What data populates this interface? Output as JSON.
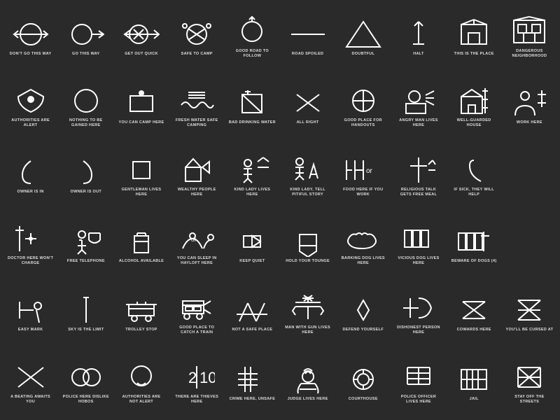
{
  "cells": [
    {
      "id": "dont-go-this-way",
      "label": "DON'T GO THIS WAY"
    },
    {
      "id": "go-this-way",
      "label": "GO THIS WAY"
    },
    {
      "id": "get-out-quick",
      "label": "GET OUT QUICK"
    },
    {
      "id": "safe-to-camp",
      "label": "SAFE TO CAMP"
    },
    {
      "id": "good-road-to-follow",
      "label": "GOOD ROAD TO FOLLOW"
    },
    {
      "id": "road-spoiled",
      "label": "ROAD SPOILED"
    },
    {
      "id": "doubtful",
      "label": "DOUBTFUL"
    },
    {
      "id": "halt",
      "label": "HALT"
    },
    {
      "id": "this-is-the-place",
      "label": "THIS IS THE PLACE"
    },
    {
      "id": "dangerous-neighborhood",
      "label": "DANGEROUS NEIGHBORHOOD"
    },
    {
      "id": "authorities-are-alert",
      "label": "AUTHORITIES ARE ALERT"
    },
    {
      "id": "nothing-to-be-gained-here",
      "label": "NOTHING TO BE GAINED HERE"
    },
    {
      "id": "you-can-camp-here",
      "label": "YOU CAN CAMP HERE"
    },
    {
      "id": "fresh-water-safe-camping",
      "label": "FRESH WATER SAFE CAMPING"
    },
    {
      "id": "bad-drinking-water",
      "label": "BAD DRINKING WATER"
    },
    {
      "id": "all-right",
      "label": "ALL RIGHT"
    },
    {
      "id": "good-place-for-handouts",
      "label": "GOOD PLACE FOR HANDOUTS"
    },
    {
      "id": "angry-man-lives-here",
      "label": "ANGRY MAN LIVES HERE"
    },
    {
      "id": "well-guarded-house",
      "label": "WELL-GUARDED HOUSE"
    },
    {
      "id": "work-here",
      "label": "WORK HERE"
    },
    {
      "id": "owner-is-in",
      "label": "OWNER IS IN"
    },
    {
      "id": "owner-is-out",
      "label": "OWNER IS OUT"
    },
    {
      "id": "gentleman-lives-here",
      "label": "GENTLEMAN LIVES HERE"
    },
    {
      "id": "wealthy-people-here",
      "label": "WEALTHY PEOPLE HERE"
    },
    {
      "id": "kind-lady-lives-here",
      "label": "KIND LADY LIVES HERE"
    },
    {
      "id": "kind-lady-tell-pitiful-story",
      "label": "KIND LADY, TELL PITIFUL STORY"
    },
    {
      "id": "food-here-if-you-work",
      "label": "FOOD HERE IF YOU WORK"
    },
    {
      "id": "religious-talk-gets-free-meal",
      "label": "RELIGIOUS TALK GETS FREE MEAL"
    },
    {
      "id": "if-sick-they-will-help",
      "label": "IF SICK, THEY WILL HELP"
    },
    {
      "id": "placeholder1",
      "label": ""
    },
    {
      "id": "doctor-here-wont-charge",
      "label": "DOCTOR HERE WON'T CHARGE"
    },
    {
      "id": "free-telephone",
      "label": "FREE TELEPHONE"
    },
    {
      "id": "alcohol-available",
      "label": "ALCOHOL AVAILABLE"
    },
    {
      "id": "you-can-sleep-in-hayloft-here",
      "label": "YOU CAN SLEEP IN HAYLOFT HERE"
    },
    {
      "id": "keep-quiet",
      "label": "KEEP QUIET"
    },
    {
      "id": "hold-your-tounge",
      "label": "HOLD YOUR TOUNGE"
    },
    {
      "id": "barking-dog-lives-here",
      "label": "BARKING DOG LIVES HERE"
    },
    {
      "id": "vicious-dog-lives-here",
      "label": "VICIOUS DOG LIVES HERE"
    },
    {
      "id": "beware-of-dogs-4",
      "label": "BEWARE OF DOGS (4)"
    },
    {
      "id": "placeholder2",
      "label": ""
    },
    {
      "id": "easy-mark",
      "label": "EASY MARK"
    },
    {
      "id": "sky-is-the-limit",
      "label": "SKY IS THE LIMIT"
    },
    {
      "id": "trolley-stop",
      "label": "TROLLEY STOP"
    },
    {
      "id": "good-place-to-catch-a-train",
      "label": "GOOD PLACE TO CATCH A TRAIN"
    },
    {
      "id": "not-a-safe-place",
      "label": "NOT A SAFE PLACE"
    },
    {
      "id": "man-with-gun-lives-here",
      "label": "MAN WITH GUN LIVES HERE"
    },
    {
      "id": "defend-yourself",
      "label": "DEFEND YOURSELF"
    },
    {
      "id": "dishonest-person-here",
      "label": "DISHONEST PERSON HERE"
    },
    {
      "id": "cowards-here",
      "label": "COWARDS HERE"
    },
    {
      "id": "youll-be-cursed-at",
      "label": "YOU'LL BE CURSED AT"
    },
    {
      "id": "a-beating-awaits-you",
      "label": "A BEATING AWAITS YOU"
    },
    {
      "id": "police-here-dislike-hobos",
      "label": "POLICE HERE DISLIKE HOBOS"
    },
    {
      "id": "authorities-are-not-alert",
      "label": "AUTHORITIES ARE NOT ALERT"
    },
    {
      "id": "there-are-thieves-here",
      "label": "THERE ARE THIEVES HERE"
    },
    {
      "id": "crime-here-unsafe",
      "label": "CRIME HERE, UNSAFE"
    },
    {
      "id": "judge-lives-here",
      "label": "JUDGE LIVES HERE"
    },
    {
      "id": "courthouse",
      "label": "COURTHOUSE"
    },
    {
      "id": "police-officer-lives-here",
      "label": "POLICE OFFICER LIVES HERE"
    },
    {
      "id": "jail",
      "label": "JAIL"
    },
    {
      "id": "stay-off-the-streets",
      "label": "STAY OFF THE STREETS"
    }
  ]
}
